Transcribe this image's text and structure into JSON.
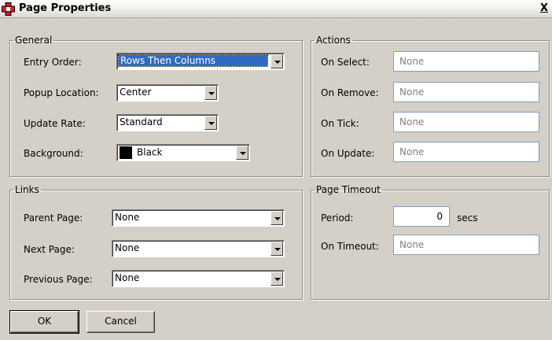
{
  "window": {
    "title": "Page Properties",
    "close_label": "X"
  },
  "general": {
    "legend": "General",
    "entry_order": {
      "label": "Entry Order:",
      "value": "Rows Then Columns"
    },
    "popup_location": {
      "label": "Popup Location:",
      "value": "Center"
    },
    "update_rate": {
      "label": "Update Rate:",
      "value": "Standard"
    },
    "background": {
      "label": "Background:",
      "value": "Black",
      "swatch_color": "#000000"
    }
  },
  "actions": {
    "legend": "Actions",
    "on_select": {
      "label": "On Select:",
      "value": "None"
    },
    "on_remove": {
      "label": "On Remove:",
      "value": "None"
    },
    "on_tick": {
      "label": "On Tick:",
      "value": "None"
    },
    "on_update": {
      "label": "On Update:",
      "value": "None"
    }
  },
  "links": {
    "legend": "Links",
    "parent_page": {
      "label": "Parent Page:",
      "value": "None"
    },
    "next_page": {
      "label": "Next Page:",
      "value": "None"
    },
    "previous_page": {
      "label": "Previous Page:",
      "value": "None"
    }
  },
  "page_timeout": {
    "legend": "Page Timeout",
    "period": {
      "label": "Period:",
      "value": "0",
      "unit": "secs"
    },
    "on_timeout": {
      "label": "On Timeout:",
      "value": "None"
    }
  },
  "buttons": {
    "ok": "OK",
    "cancel": "Cancel"
  }
}
